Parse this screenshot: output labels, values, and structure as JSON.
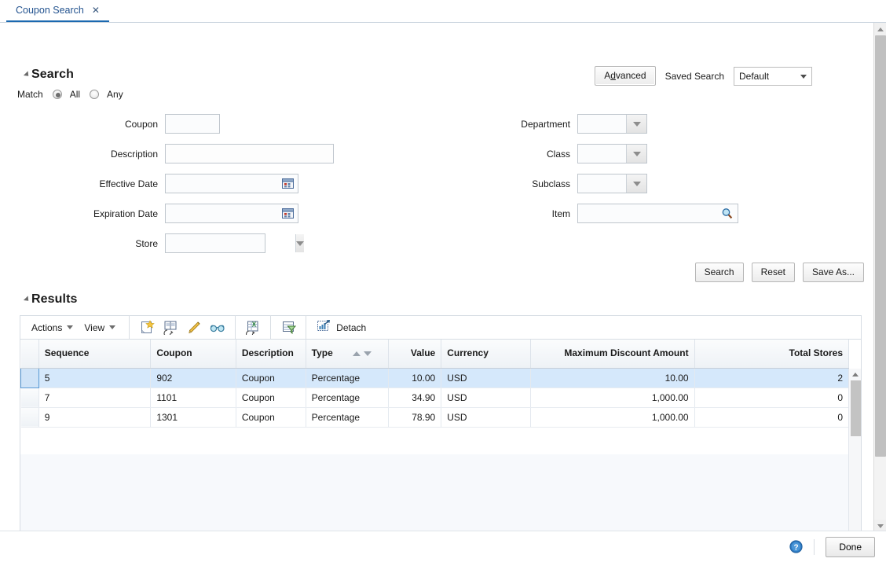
{
  "tab": {
    "label": "Coupon Search",
    "close": "✕"
  },
  "search": {
    "title": "Search",
    "match_label": "Match",
    "match_options": [
      {
        "label": "All",
        "selected": true
      },
      {
        "label": "Any",
        "selected": false
      }
    ],
    "advanced_button": "Advanced",
    "advanced_accesskey": "d",
    "saved_search_label": "Saved Search",
    "saved_search_value": "Default",
    "fields_left": [
      {
        "label": "Coupon",
        "value": "",
        "type": "text"
      },
      {
        "label": "Description",
        "value": "",
        "type": "text"
      },
      {
        "label": "Effective Date",
        "value": "",
        "type": "date"
      },
      {
        "label": "Expiration Date",
        "value": "",
        "type": "date"
      },
      {
        "label": "Store",
        "value": "",
        "type": "lov"
      }
    ],
    "fields_right": [
      {
        "label": "Department",
        "value": "",
        "type": "lov"
      },
      {
        "label": "Class",
        "value": "",
        "type": "lov"
      },
      {
        "label": "Subclass",
        "value": "",
        "type": "lov"
      },
      {
        "label": "Item",
        "value": "",
        "type": "search"
      }
    ],
    "buttons": [
      {
        "label": "Search"
      },
      {
        "label": "Reset"
      },
      {
        "label": "Save As..."
      }
    ]
  },
  "results": {
    "title": "Results",
    "toolbar": {
      "actions_menu": "Actions",
      "view_menu": "View",
      "detach_label": "Detach",
      "icons": [
        "create-icon",
        "duplicate-icon",
        "edit-icon",
        "view-glasses-icon",
        "export-to-excel-icon",
        "query-by-example-icon",
        "detach-icon"
      ]
    },
    "columns": [
      {
        "label": "Sequence",
        "align": "left"
      },
      {
        "label": "Coupon",
        "align": "left"
      },
      {
        "label": "Description",
        "align": "left"
      },
      {
        "label": "Type",
        "align": "left",
        "sortable": true
      },
      {
        "label": "Value",
        "align": "right"
      },
      {
        "label": "Currency",
        "align": "left"
      },
      {
        "label": "Maximum Discount Amount",
        "align": "right"
      },
      {
        "label": "Total Stores",
        "align": "right"
      }
    ],
    "rows": [
      {
        "selected": true,
        "sequence": "5",
        "coupon": "902",
        "description": "Coupon",
        "type": "Percentage",
        "value": "10.00",
        "currency": "USD",
        "max_discount": "10.00",
        "total_stores": "2"
      },
      {
        "selected": false,
        "sequence": "7",
        "coupon": "1101",
        "description": "Coupon",
        "type": "Percentage",
        "value": "34.90",
        "currency": "USD",
        "max_discount": "1,000.00",
        "total_stores": "0"
      },
      {
        "selected": false,
        "sequence": "9",
        "coupon": "1301",
        "description": "Coupon",
        "type": "Percentage",
        "value": "78.90",
        "currency": "USD",
        "max_discount": "1,000.00",
        "total_stores": "0"
      }
    ]
  },
  "footer": {
    "help_icon": "help-icon",
    "done_button": "Done"
  },
  "colors": {
    "tab_accent": "#1b69b0",
    "link": "#2a5d9e",
    "selected_row": "#d5e8fb",
    "header_gradient_top": "#fbfcfd",
    "header_gradient_bottom": "#eef2f6"
  }
}
